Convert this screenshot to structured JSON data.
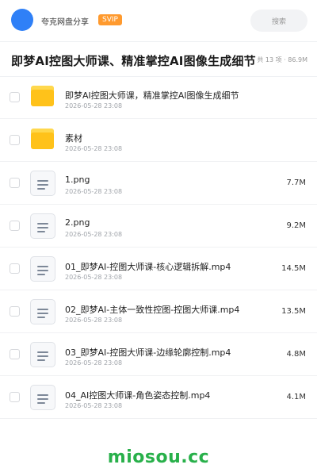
{
  "header": {
    "brand": "夸克网盘分享",
    "badge": "SVIP",
    "search_placeholder": "搜索"
  },
  "share": {
    "title": "即梦AI控图大师课、精准掌控AI图像生成细节",
    "summary": "共 13 项 · 86.9M"
  },
  "files": [
    {
      "type": "folder",
      "name": "即梦AI控图大师课，精准掌控AI图像生成细节",
      "date": "2026-05-28 23:08",
      "size": ""
    },
    {
      "type": "folder",
      "name": "素材",
      "date": "2026-05-28 23:08",
      "size": ""
    },
    {
      "type": "file",
      "name": "1.png",
      "date": "2026-05-28 23:08",
      "size": "7.7M"
    },
    {
      "type": "file",
      "name": "2.png",
      "date": "2026-05-28 23:08",
      "size": "9.2M"
    },
    {
      "type": "file",
      "name": "01_即梦AI-控图大师课-核心逻辑拆解.mp4",
      "date": "2026-05-28 23:08",
      "size": "14.5M"
    },
    {
      "type": "file",
      "name": "02_即梦AI-主体一致性控图-控图大师课.mp4",
      "date": "2026-05-28 23:08",
      "size": "13.5M"
    },
    {
      "type": "file",
      "name": "03_即梦AI-控图大师课-边缘轮廓控制.mp4",
      "date": "2026-05-28 23:08",
      "size": "4.8M"
    },
    {
      "type": "file",
      "name": "04_AI控图大师课-角色姿态控制.mp4",
      "date": "2026-05-28 23:08",
      "size": "4.1M"
    }
  ],
  "watermark": "miosou.cc",
  "colors": {
    "accent": "#2f80f7",
    "badge": "#ff9a2e",
    "folder": "#ffc21a",
    "watermark": "#28b04a"
  }
}
